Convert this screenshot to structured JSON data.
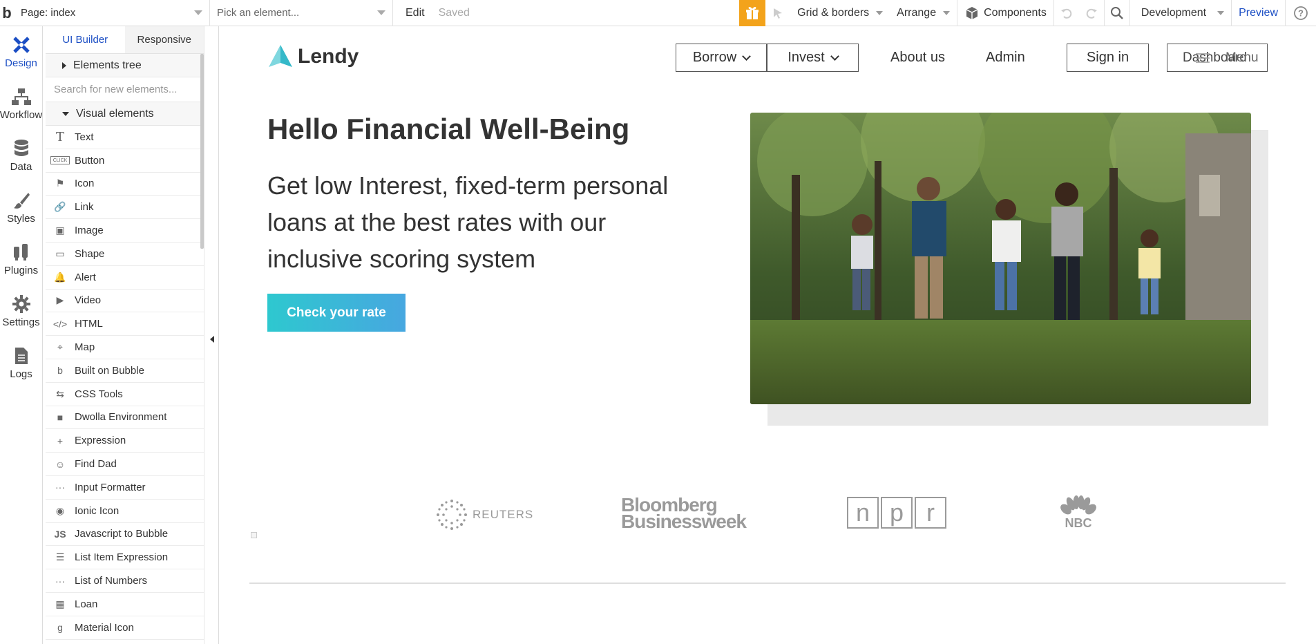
{
  "topbar": {
    "page_select": "Page: index",
    "element_select_placeholder": "Pick an element...",
    "edit_label": "Edit",
    "saved_label": "Saved",
    "grid_label": "Grid & borders",
    "arrange_label": "Arrange",
    "components_label": "Components",
    "env_label": "Development",
    "preview_label": "Preview"
  },
  "rail": {
    "items": [
      {
        "label": "Design",
        "icon": "design-icon"
      },
      {
        "label": "Workflow",
        "icon": "workflow-icon"
      },
      {
        "label": "Data",
        "icon": "database-icon"
      },
      {
        "label": "Styles",
        "icon": "brush-icon"
      },
      {
        "label": "Plugins",
        "icon": "plug-icon"
      },
      {
        "label": "Settings",
        "icon": "gear-icon"
      },
      {
        "label": "Logs",
        "icon": "document-icon"
      }
    ]
  },
  "panel": {
    "tabs": [
      "UI Builder",
      "Responsive"
    ],
    "elements_tree_label": "Elements tree",
    "search_placeholder": "Search for new elements...",
    "visual_elements_label": "Visual elements",
    "items": [
      {
        "label": "Text",
        "icon": "T"
      },
      {
        "label": "Button",
        "icon": "CLICK"
      },
      {
        "label": "Icon",
        "icon": "⚑"
      },
      {
        "label": "Link",
        "icon": "🔗"
      },
      {
        "label": "Image",
        "icon": "▣"
      },
      {
        "label": "Shape",
        "icon": "▭"
      },
      {
        "label": "Alert",
        "icon": "🔔"
      },
      {
        "label": "Video",
        "icon": "▶"
      },
      {
        "label": "HTML",
        "icon": "</>"
      },
      {
        "label": "Map",
        "icon": "⌖"
      },
      {
        "label": "Built on Bubble",
        "icon": "b"
      },
      {
        "label": "CSS Tools",
        "icon": "⇆"
      },
      {
        "label": "Dwolla Environment",
        "icon": "■"
      },
      {
        "label": "Expression",
        "icon": "+"
      },
      {
        "label": "Find Dad",
        "icon": "☺"
      },
      {
        "label": "Input Formatter",
        "icon": "···"
      },
      {
        "label": "Ionic Icon",
        "icon": "◉"
      },
      {
        "label": "Javascript to Bubble",
        "icon": "JS"
      },
      {
        "label": "List Item Expression",
        "icon": "☰"
      },
      {
        "label": "List of Numbers",
        "icon": "···"
      },
      {
        "label": "Loan",
        "icon": "▦"
      },
      {
        "label": "Material Icon",
        "icon": "g"
      }
    ]
  },
  "site": {
    "brand": "Lendy",
    "nav": {
      "borrow": "Borrow",
      "invest": "Invest",
      "about": "About us",
      "admin": "Admin",
      "signin": "Sign in",
      "dashboard_overlap": "Dashboard",
      "menu_overlap": "Menu"
    },
    "hero_title": "Hello Financial Well-Being",
    "hero_subtitle": "Get low Interest, fixed-term personal loans at the best rates with our inclusive scoring system",
    "cta": "Check your rate",
    "press": [
      "REUTERS",
      "Bloomberg",
      "Businessweek",
      "n",
      "p",
      "r",
      "NBC"
    ]
  },
  "colors": {
    "accent_blue": "#1b4ec4",
    "gift_orange": "#f3a31b",
    "cta_start": "#2ec8cf",
    "cta_end": "#47a7e0",
    "brand_teal": "#35b9c9"
  }
}
